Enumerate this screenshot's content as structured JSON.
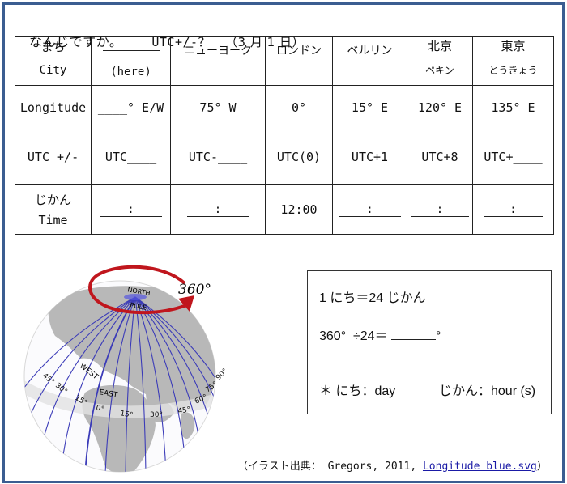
{
  "title": {
    "question": "なんじですか。",
    "utc_prompt": "UTC+/-？",
    "date": "（3 月 1 日）"
  },
  "table": {
    "header_row": {
      "label_jp": "まち",
      "label_en": "City",
      "cities": [
        {
          "name": "",
          "sub": "(here)",
          "blank": true
        },
        {
          "name": "ニューヨーク",
          "sub": ""
        },
        {
          "name": "ロンドン",
          "sub": ""
        },
        {
          "name": "ベルリン",
          "sub": ""
        },
        {
          "name": "北京",
          "sub": "ペキン"
        },
        {
          "name": "東京",
          "sub": "とうきょう"
        }
      ]
    },
    "longitude_row": {
      "label": "Longitude",
      "values": [
        "____° E/W",
        "75° W",
        "0°",
        "15° E",
        "120° E",
        "135° E"
      ]
    },
    "utc_row": {
      "label": "UTC +/-",
      "values": [
        "UTC____",
        "UTC-____",
        "UTC(0)",
        "UTC+1",
        "UTC+8",
        "UTC+____"
      ]
    },
    "time_row": {
      "label_jp": "じかん",
      "label_en": "Time",
      "values": [
        ":",
        ":",
        "12:00",
        ":",
        ":",
        ":"
      ],
      "filled": [
        false,
        false,
        true,
        false,
        false,
        false
      ]
    }
  },
  "globe": {
    "rotation_label": "360°",
    "north_pole_label_1": "NORTH",
    "north_pole_label_2": "POLE",
    "west_label": "WEST",
    "east_label": "EAST",
    "meridian_labels": [
      "45°",
      "30°",
      "15°",
      "0°",
      "15°",
      "30°",
      "45°",
      "60°",
      "75°",
      "90°"
    ],
    "arrow_color": "#c0161d",
    "meridian_color": "#3b3bb8",
    "land_color": "#b8b8b8"
  },
  "info_box": {
    "line1": "1 にち＝24 じかん",
    "line2_prefix": "360°  ÷24＝ ",
    "line2_suffix": "°",
    "note_day": "＊ にち：day",
    "note_hour": "じかん：hour (s)"
  },
  "credit": {
    "prefix": "（イラスト出典： Gregors, 2011, ",
    "link": "Longitude blue.svg",
    "suffix": "）"
  },
  "colors": {
    "frame_border": "#3b5d91",
    "link": "#1a1aa6"
  }
}
